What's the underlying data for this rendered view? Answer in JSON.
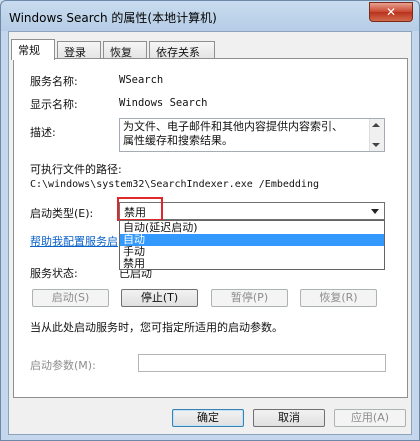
{
  "window": {
    "title": "Windows Search 的属性(本地计算机)",
    "close_label": "✕"
  },
  "tabs": [
    {
      "label": "常规",
      "active": true
    },
    {
      "label": "登录",
      "active": false
    },
    {
      "label": "恢复",
      "active": false
    },
    {
      "label": "依存关系",
      "active": false
    }
  ],
  "general": {
    "service_name_label": "服务名称:",
    "service_name_value": "WSearch",
    "display_name_label": "显示名称:",
    "display_name_value": "Windows Search",
    "description_label": "描述:",
    "description_line1": "为文件、电子邮件和其他内容提供内容索引、",
    "description_line2": "属性缓存和搜索结果。",
    "exe_path_label": "可执行文件的路径:",
    "exe_path_value": "C:\\windows\\system32\\SearchIndexer.exe /Embedding",
    "startup_type_label": "启动类型(E):",
    "startup_type_value": "禁用",
    "startup_options": [
      {
        "label": "自动(延迟启动)",
        "selected": false
      },
      {
        "label": "自动",
        "selected": true
      },
      {
        "label": "手动",
        "selected": false
      },
      {
        "label": "禁用",
        "selected": false
      }
    ],
    "help_link": "帮助我配置服务启",
    "service_status_label": "服务状态:",
    "service_status_value": "已启动",
    "start_btn": "启动(S)",
    "stop_btn": "停止(T)",
    "pause_btn": "暂停(P)",
    "resume_btn": "恢复(R)",
    "hint_text": "当从此处启动服务时，您可指定所适用的启动参数。",
    "start_params_label": "启动参数(M):",
    "start_params_value": ""
  },
  "footer": {
    "ok": "确定",
    "cancel": "取消",
    "apply": "应用(A)"
  },
  "colors": {
    "selection": "#3399ff",
    "highlight_box": "#e0282a",
    "link": "#0a62c9"
  }
}
